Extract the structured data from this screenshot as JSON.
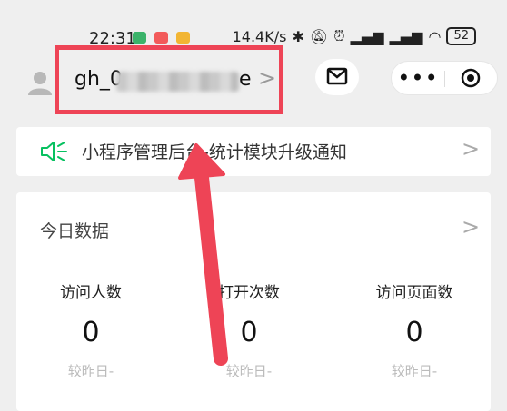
{
  "status_bar": {
    "time": "22:31",
    "network_speed": "14.4K/s",
    "battery": "52"
  },
  "header": {
    "account_prefix": "gh_0",
    "account_suffix": "e",
    "account_chevron": ">"
  },
  "capsule": {
    "more_label": "•••"
  },
  "notice": {
    "text": "小程序管理后台-统计模块升级通知",
    "chevron": ">"
  },
  "today_data": {
    "title": "今日数据",
    "chevron": ">",
    "metrics": [
      {
        "label": "访问人数",
        "value": "0",
        "comparison": "较昨日-"
      },
      {
        "label": "打开次数",
        "value": "0",
        "comparison": "较昨日-"
      },
      {
        "label": "访问页面数",
        "value": "0",
        "comparison": "较昨日-"
      }
    ]
  },
  "colors": {
    "highlight": "#ee4456",
    "accent_green": "#07c160",
    "background": "#efefef"
  },
  "icons": [
    "person-avatar-icon",
    "mail-icon",
    "more-dots-icon",
    "close-circle-icon",
    "speaker-icon",
    "chevron-right-icon",
    "bluetooth-icon",
    "mute-icon",
    "alarm-icon",
    "signal-icon",
    "wifi-icon"
  ]
}
